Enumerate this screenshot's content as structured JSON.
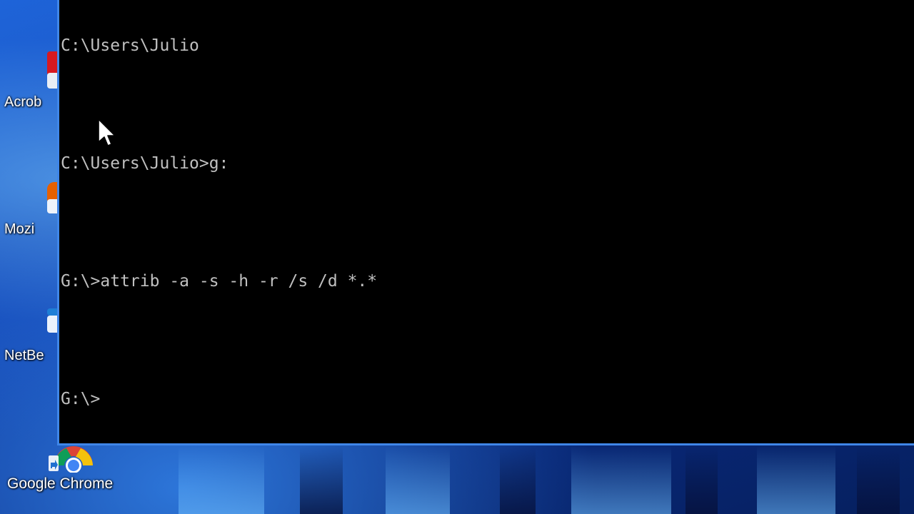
{
  "desktop": {
    "icons": [
      {
        "label": "Acrob",
        "icon": "acrobat-icon",
        "color": "#d71920"
      },
      {
        "label": "Mozi",
        "icon": "firefox-icon",
        "color": "#e66000"
      },
      {
        "label": "NetBe",
        "icon": "netbeans-icon",
        "color": "#1e7fd6"
      }
    ],
    "chrome": {
      "label": "Google Chrome",
      "icon": "chrome-icon"
    }
  },
  "console": {
    "lines": [
      "C:\\Users\\Julio",
      "",
      "C:\\Users\\Julio>g:",
      "",
      "G:\\>attrib -a -s -h -r /s /d *.*",
      "",
      "G:\\>"
    ],
    "text_color": "#c0c0c0",
    "background": "#000000"
  },
  "cursor": {
    "icon": "mouse-pointer-icon"
  }
}
